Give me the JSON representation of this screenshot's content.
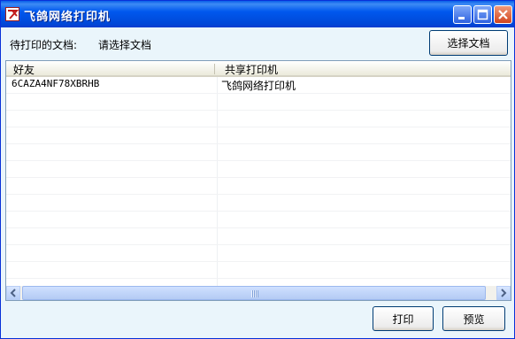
{
  "window": {
    "title": "飞鸽网络打印机"
  },
  "toolbar": {
    "doc_label": "待打印的文档:",
    "doc_value": "请选择文档",
    "choose_button": "选择文档"
  },
  "table": {
    "columns": [
      "好友",
      "共享打印机"
    ],
    "rows": [
      {
        "friend": "6CAZA4NF78XBRHB",
        "printer": "飞鸽网络打印机"
      }
    ]
  },
  "footer": {
    "print_button": "打印",
    "preview_button": "预览"
  },
  "colors": {
    "titlebar": "#0054e3",
    "window_bg": "#eaf5fb",
    "close_button": "#d2451e"
  },
  "icons": [
    "app-icon",
    "minimize-icon",
    "maximize-icon",
    "close-icon",
    "scroll-left-icon",
    "scroll-right-icon"
  ]
}
